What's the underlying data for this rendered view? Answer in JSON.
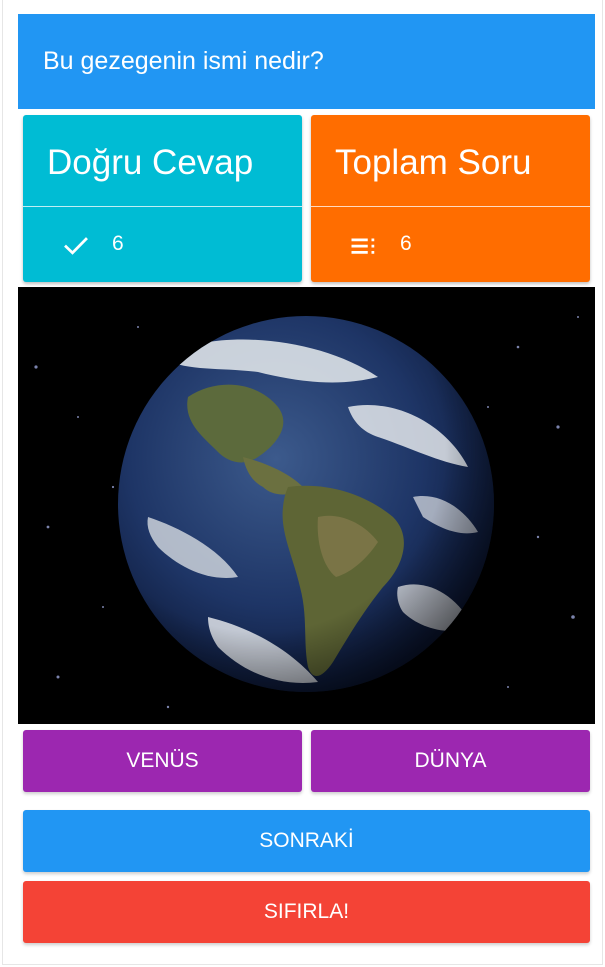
{
  "question": {
    "text": "Bu gezegenin ismi nedir?"
  },
  "stats": {
    "correct": {
      "label": "Doğru Cevap",
      "value": "6",
      "icon": "check-icon"
    },
    "total": {
      "label": "Toplam Soru",
      "value": "6",
      "icon": "list-icon"
    }
  },
  "image": {
    "subject": "planet-earth-photo"
  },
  "answers": [
    {
      "label": "VENÜS"
    },
    {
      "label": "DÜNYA"
    }
  ],
  "actions": {
    "next_label": "SONRAKİ",
    "reset_label": "SIFIRLA!"
  },
  "colors": {
    "question_bar": "#2196f3",
    "correct_card": "#00bcd4",
    "total_card": "#ff6d00",
    "answer_button": "#9c27b0",
    "next_button": "#2196f3",
    "reset_button": "#f44336"
  }
}
